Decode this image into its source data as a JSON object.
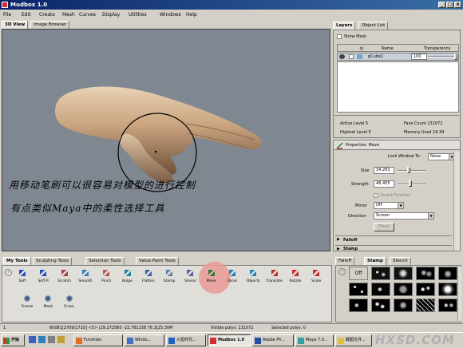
{
  "window": {
    "title": "Mudbox 1.0",
    "controls": [
      "_",
      "□",
      "x"
    ]
  },
  "menu": [
    "File",
    "Edit",
    "Create",
    "Mesh",
    "Curves",
    "Display",
    "Utilities",
    "Windows",
    "Help"
  ],
  "viewport": {
    "tabs": [
      "3D View",
      "Image Browser"
    ],
    "annotation_line1": "用移动笔刷可以很容易对模型的进行控制",
    "annotation_line2": "有点类似Maya中的柔性选择工具"
  },
  "layers": {
    "tabs": [
      "Layers",
      "Object List"
    ],
    "show_mask": "Show Mask",
    "columns": [
      "",
      ".o|",
      "Name",
      "Transparency"
    ],
    "row": {
      "name": "pCube1",
      "transparency": "100"
    },
    "active_level": "Active Level 5",
    "face_count": "Face Count 131072",
    "highest_level": "Highest Level 5",
    "memory_used": "Memory Used 19.34"
  },
  "properties": {
    "title": "Properties: Move",
    "lock_window_to_label": "Lock Window To:",
    "lock_window_to_value": "None",
    "size_label": "Size",
    "size_value": "34.283",
    "strength_label": "Strength",
    "strength_value": "48.455",
    "invert_function": "Invert Function",
    "mirror_label": "Mirror",
    "mirror_value": "Off",
    "direction_label": "Direction",
    "direction_value": "Screen",
    "flood_button": "Flood",
    "falloff_section": "Falloff",
    "stamp_section": "Stamp"
  },
  "tool_shelf": {
    "tabs": [
      "My Tools",
      "Sculpting Tools",
      "Selection Tools",
      "Value Paint Tools"
    ],
    "row1": [
      "Soft",
      "Soft R",
      "Scratch",
      "Smooth",
      "Pinch",
      "Bulge",
      "Flatten",
      "Stamp",
      "Smear",
      "Move",
      "Faces",
      "Objects",
      "Translate",
      "Rotate",
      "Scale"
    ],
    "row2": [
      "Freeze",
      "Mask",
      "Erase"
    ]
  },
  "stamp_panel": {
    "tabs": [
      "Falloff",
      "Stamp",
      "Stencil"
    ],
    "off_label": "Off"
  },
  "status": {
    "left": "1",
    "coords": "60081[2709/2710] <5> (29.272560 -22.781158 76.3[25.30M",
    "visible_polys": "Visible polys: 131072",
    "selected_polys": "Selected polys: 0"
  },
  "taskbar": {
    "start": "开始",
    "items": [
      "Funshion",
      "Windo...",
      "火星时代...",
      "Mudbox 1.0",
      "Adobe Ph...",
      "Maya 7.0...",
      "截图文件..."
    ],
    "watermark": "HXSD.COM"
  },
  "colors": {
    "title_bar": "#0a246a",
    "viewport_bg": "#7f8790",
    "highlight_circle": "#e89a98",
    "accent_red": "#d03030"
  }
}
